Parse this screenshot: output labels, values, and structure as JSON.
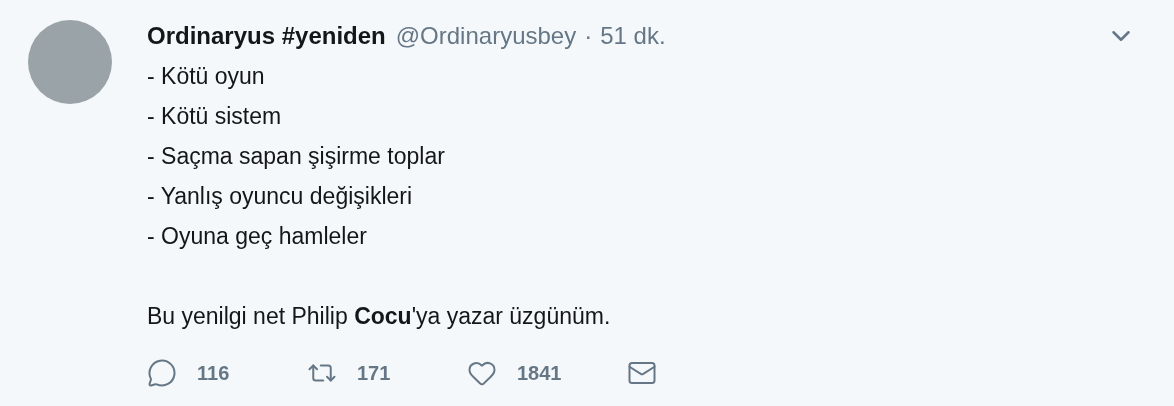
{
  "tweet": {
    "name": "Ordinaryus #yeniden",
    "handle": "@Ordinaryusbey",
    "separator": "·",
    "time": "51 dk.",
    "paragraphs": [
      {
        "lines": [
          "- Kötü oyun",
          "- Kötü sistem",
          "- Saçma sapan şişirme toplar",
          "- Yanlış oyuncu değişikleri",
          "- Oyuna geç hamleler"
        ]
      },
      {
        "lines": [
          "Bu yenilgi net Philip **Cocu**'ya yazar üzgünüm."
        ]
      }
    ],
    "actions": [
      {
        "kind": "reply",
        "count": "116"
      },
      {
        "kind": "retweet",
        "count": "171"
      },
      {
        "kind": "like",
        "count": "1841"
      },
      {
        "kind": "message"
      }
    ]
  }
}
